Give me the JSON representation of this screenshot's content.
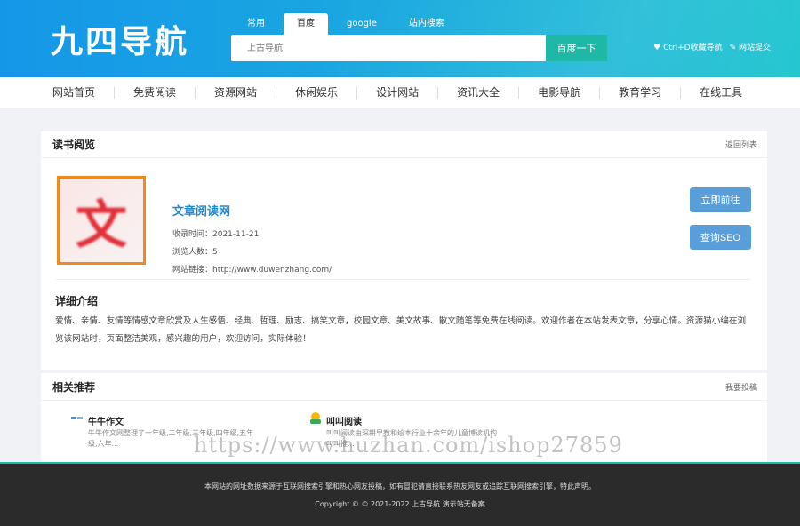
{
  "header": {
    "logo": "九四导航",
    "search_tabs": [
      "常用",
      "百度",
      "google",
      "站内搜索"
    ],
    "active_tab": 1,
    "search_placeholder": "上古导航",
    "search_button": "百度一下",
    "links": [
      "♥ Ctrl+D收藏导航",
      "✎ 网站提交"
    ]
  },
  "nav": [
    "网站首页",
    "免费阅读",
    "资源网站",
    "休闲娱乐",
    "设计网站",
    "资讯大全",
    "电影导航",
    "教育学习",
    "在线工具"
  ],
  "main": {
    "section_title": "读书阅览",
    "back_link": "返回列表",
    "site": {
      "thumb_char": "文",
      "name": "文章阅读网",
      "date_label": "收录时间：2021-11-21",
      "views_label": "浏览人数：5",
      "url_label": "网站链接：http://www.duwenzhang.com/"
    },
    "buttons": {
      "visit": "立即前往",
      "seo": "查询SEO"
    },
    "detail_title": "详细介绍",
    "detail_text": "爱情、亲情、友情等情感文章欣赏及人生感悟、经典、哲理、励志、搞笑文章，校园文章、美文故事、散文随笔等免费在线阅读。欢迎作者在本站发表文章，分享心情。资源猫小编在浏览该网站时，页面整洁美观，感兴趣的用户，欢迎访问，实际体验！"
  },
  "related": {
    "title": "相关推荐",
    "link": "我要投稿",
    "items": [
      {
        "name": "牛牛作文",
        "desc": "牛牛作文网整理了一年级,二年级,三年级,四年级,五年级,六年..."
      },
      {
        "name": "叫叫阅读",
        "desc": "叫叫阅读由深耕早教和绘本行业十余年的儿童博读机构 叫叫推..."
      }
    ]
  },
  "footer": {
    "line1": "本网站的网址数据来源于互联网搜索引擎和热心网友投稿，如有冒犯请直接联系热友网友或追踪互联网搜索引擎，特此声明。",
    "line2": "Copyright © © 2021-2022 上古导航 演示站无备案"
  },
  "watermark": "https://www.huzhan.com/ishop27859",
  "colors": {
    "header_start": "#1597e8",
    "header_end": "#1cc4cf",
    "accent": "#1fb8a6",
    "button": "#5a9ed9",
    "link": "#1d8ad6"
  }
}
